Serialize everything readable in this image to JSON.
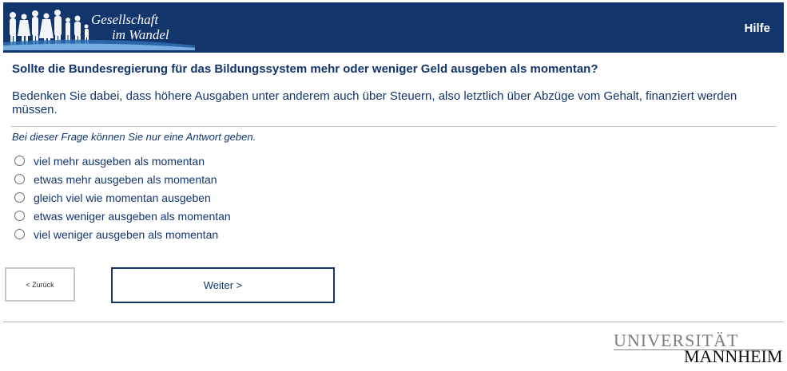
{
  "header": {
    "logo_line1": "Gesellschaft",
    "logo_line2": "im Wandel",
    "help_label": "Hilfe",
    "background_color": "#12356c"
  },
  "question": {
    "title": "Sollte die Bundesregierung für das Bildungssystem mehr oder weniger Geld ausgeben als momentan?",
    "hint": "Bedenken Sie dabei, dass höhere Ausgaben unter anderem auch über Steuern, also letztlich über Abzüge vom Gehalt, finanziert werden müssen.",
    "instruction": "Bei dieser Frage können Sie nur eine Antwort geben.",
    "options": [
      "viel mehr ausgeben als momentan",
      "etwas mehr ausgeben als momentan",
      "gleich viel wie momentan ausgeben",
      "etwas weniger ausgeben als momentan",
      "viel weniger ausgeben als momentan"
    ]
  },
  "navigation": {
    "back_label": "< Zurück",
    "next_label": "Weiter >"
  },
  "footer": {
    "logo_top": "UNIVERSITÄT",
    "logo_bottom": "MANNHEIM"
  }
}
